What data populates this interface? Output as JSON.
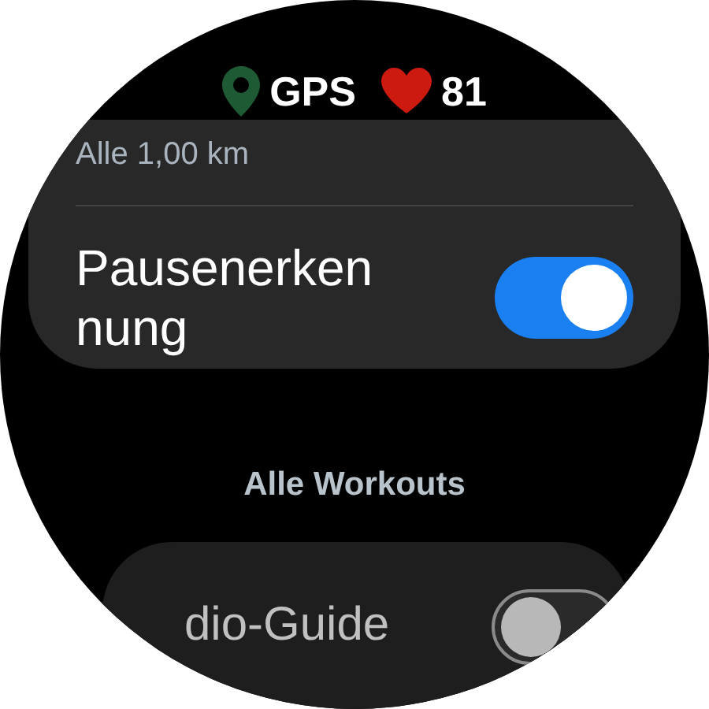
{
  "status_bar": {
    "gps_label": "GPS",
    "heart_rate": "81"
  },
  "settings_card": {
    "interval_value": "Alle 1,00 km",
    "toggle": {
      "label_lines": [
        "Pausenerken",
        "nung"
      ],
      "on": true
    }
  },
  "section_header": "Alle Workouts",
  "second_card": {
    "toggle": {
      "label": "dio-Guide",
      "on": false
    }
  }
}
